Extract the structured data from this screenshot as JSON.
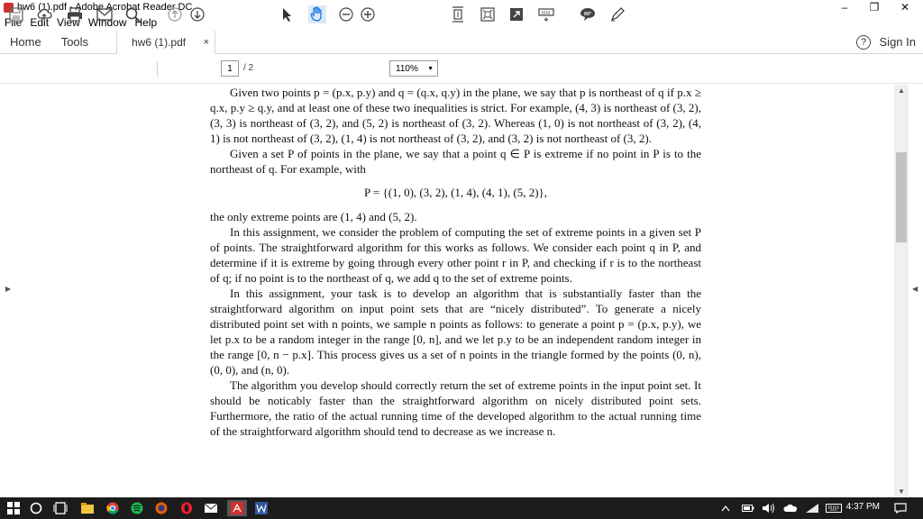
{
  "window": {
    "title": "hw6 (1).pdf - Adobe Acrobat Reader DC",
    "minimize": "–",
    "restore": "❐",
    "close": "✕"
  },
  "menu": [
    "File",
    "Edit",
    "View",
    "Window",
    "Help"
  ],
  "tabs": {
    "home": "Home",
    "tools": "Tools",
    "document": "hw6 (1).pdf",
    "close": "×",
    "help": "?",
    "sign_in": "Sign In"
  },
  "toolbar": {
    "page_current": "1",
    "page_total": "/ 2",
    "zoom": "110%",
    "icons": [
      "save-icon",
      "cloud-upload-icon",
      "print-icon",
      "email-icon",
      "search-icon",
      "page-up-icon",
      "page-down-icon",
      "select-cursor-icon",
      "hand-tool-icon",
      "zoom-out-icon",
      "zoom-in-icon",
      "fit-page-icon",
      "rotate-icon",
      "fullscreen-icon",
      "keyboard-icon",
      "comment-icon",
      "highlight-pen-icon"
    ]
  },
  "document": {
    "paragraphs": [
      "Given two points p = (p.x, p.y) and q = (q.x, q.y) in the plane, we say that p is northeast of q if p.x ≥ q.x, p.y ≥ q.y, and at least one of these two inequalities is strict. For example, (4, 3) is northeast of (3, 2), (3, 3) is northeast of (3, 2), and (5, 2) is northeast of (3, 2). Whereas (1, 0) is not northeast of (3, 2), (4, 1) is not northeast of (3, 2), (1, 4) is not northeast of (3, 2), and (3, 2) is not northeast of (3, 2).",
      "Given a set P of points in the plane, we say that a point q ∈ P is extreme if no point in P is to the northeast of q. For example, with"
    ],
    "display": "P = {(1, 0), (3, 2), (1, 4), (4, 1), (5, 2)},",
    "after_display": "the only extreme points are (1, 4) and (5, 2).",
    "paragraphs2": [
      "In this assignment, we consider the problem of computing the set of extreme points in a given set P of points. The straightforward algorithm for this works as follows. We consider each point q in P, and determine if it is extreme by going through every other point r in P, and checking if r is to the northeast of q; if no point is to the northeast of q, we add q to the set of extreme points.",
      "In this assignment, your task is to develop an algorithm that is substantially faster than the straightforward algorithm on input point sets that are “nicely distributed”. To generate a nicely distributed point set with n points, we sample n points as follows: to generate a point p = (p.x, p.y), we let p.x to be a random integer in the range [0, n], and we let p.y to be an independent random integer in the range [0, n − p.x]. This process gives us a set of n points in the triangle formed by the points (0, n), (0, 0), and (n, 0).",
      "The algorithm you develop should correctly return the set of extreme points in the input point set. It should be noticably faster than the straightforward algorithm on nicely distributed point sets. Furthermore, the ratio of the actual running time of the developed algorithm to the actual running time of the straightforward algorithm should tend to decrease as we increase n."
    ]
  },
  "taskbar": {
    "time": "4:37 PM",
    "icons": [
      "windows-start-icon",
      "cortana-icon",
      "task-view-icon",
      "file-explorer-icon",
      "chrome-icon",
      "spotify-icon",
      "firefox-icon",
      "opera-icon",
      "mail-icon",
      "acrobat-icon",
      "word-icon",
      "chevron-up-icon",
      "battery-icon",
      "volume-icon",
      "onedrive-icon",
      "wifi-icon",
      "keyboard-icon",
      "notification-icon"
    ]
  },
  "colors": {
    "acrobat_red": "#d32f2f",
    "taskbar_bg": "#1c1c1c",
    "word_blue": "#2b579a"
  }
}
